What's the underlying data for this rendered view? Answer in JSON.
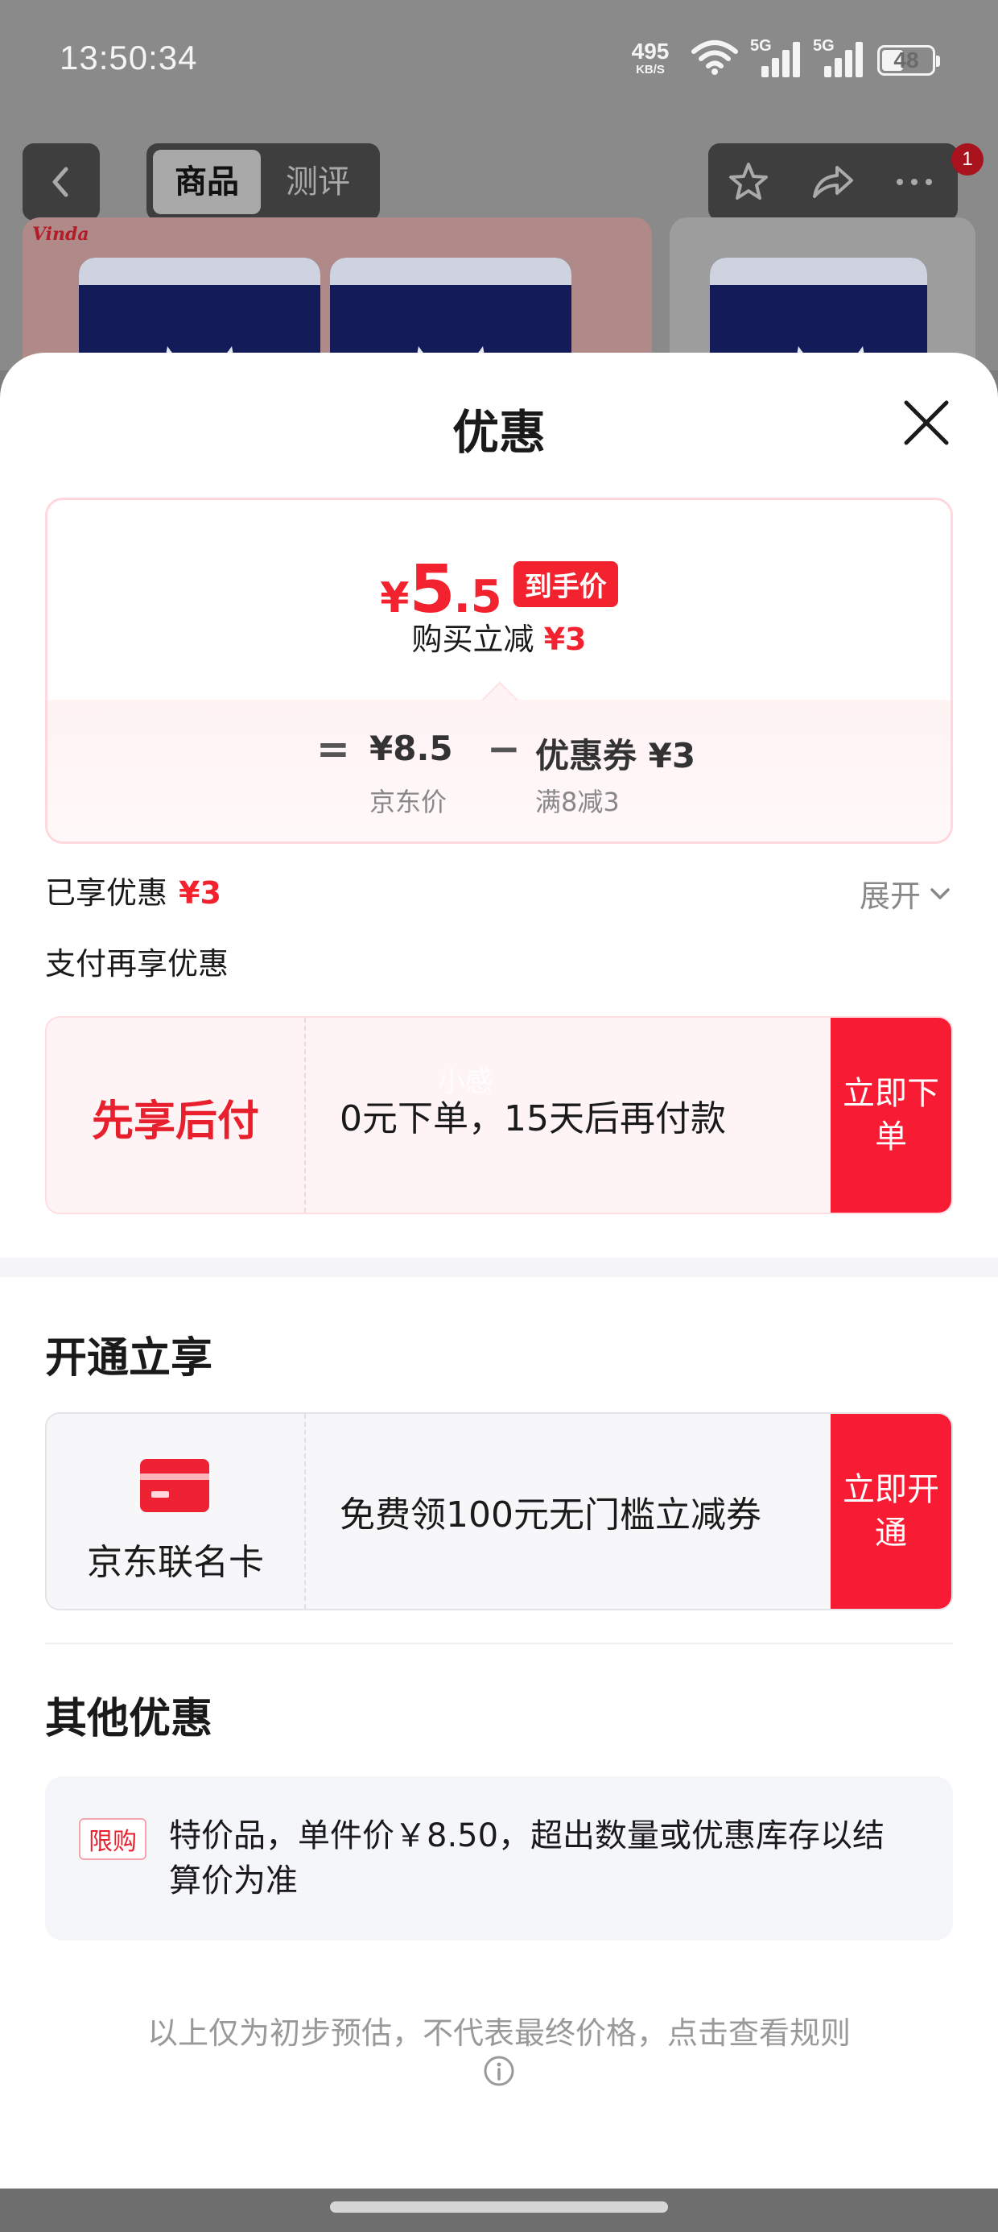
{
  "status_bar": {
    "time": "13:50:34",
    "net_speed": "495",
    "net_unit": "KB/S",
    "sim1": "5G",
    "sim2": "5G",
    "battery": "48"
  },
  "nav": {
    "tab_product": "商品",
    "tab_review": "测评",
    "notification_count": "1"
  },
  "background": {
    "brand": "Vinda"
  },
  "sheet": {
    "title": "优惠",
    "price": {
      "currency": "¥",
      "integer": "5",
      "decimal": ".5",
      "tag": "到手价",
      "instant_label": "购买立减",
      "instant_amount": "¥3",
      "equals": "=",
      "minus": "−",
      "jd_price": "¥8.5",
      "jd_price_label": "京东价",
      "coupon": "优惠券 ¥3",
      "coupon_rule": "满8减3"
    },
    "enjoyed_label": "已享优惠",
    "enjoyed_amount": "¥3",
    "expand_label": "展开",
    "pay_more_label": "支付再享优惠",
    "bnpl": {
      "label": "先享后付",
      "desc": "0元下单，15天后再付款",
      "cta": "立即下单",
      "watermark": "小感"
    },
    "open_section_title": "开通立享",
    "co_card": {
      "name": "京东联名卡",
      "desc": "免费领100元无门槛立减券",
      "cta": "立即开通"
    },
    "other_section_title": "其他优惠",
    "limit": {
      "tag": "限购",
      "text": "特价品，单件价￥8.50，超出数量或优惠库存以结算价为准"
    },
    "footer_note": "以上仅为初步预估，不代表最终价格，点击查看规则"
  }
}
